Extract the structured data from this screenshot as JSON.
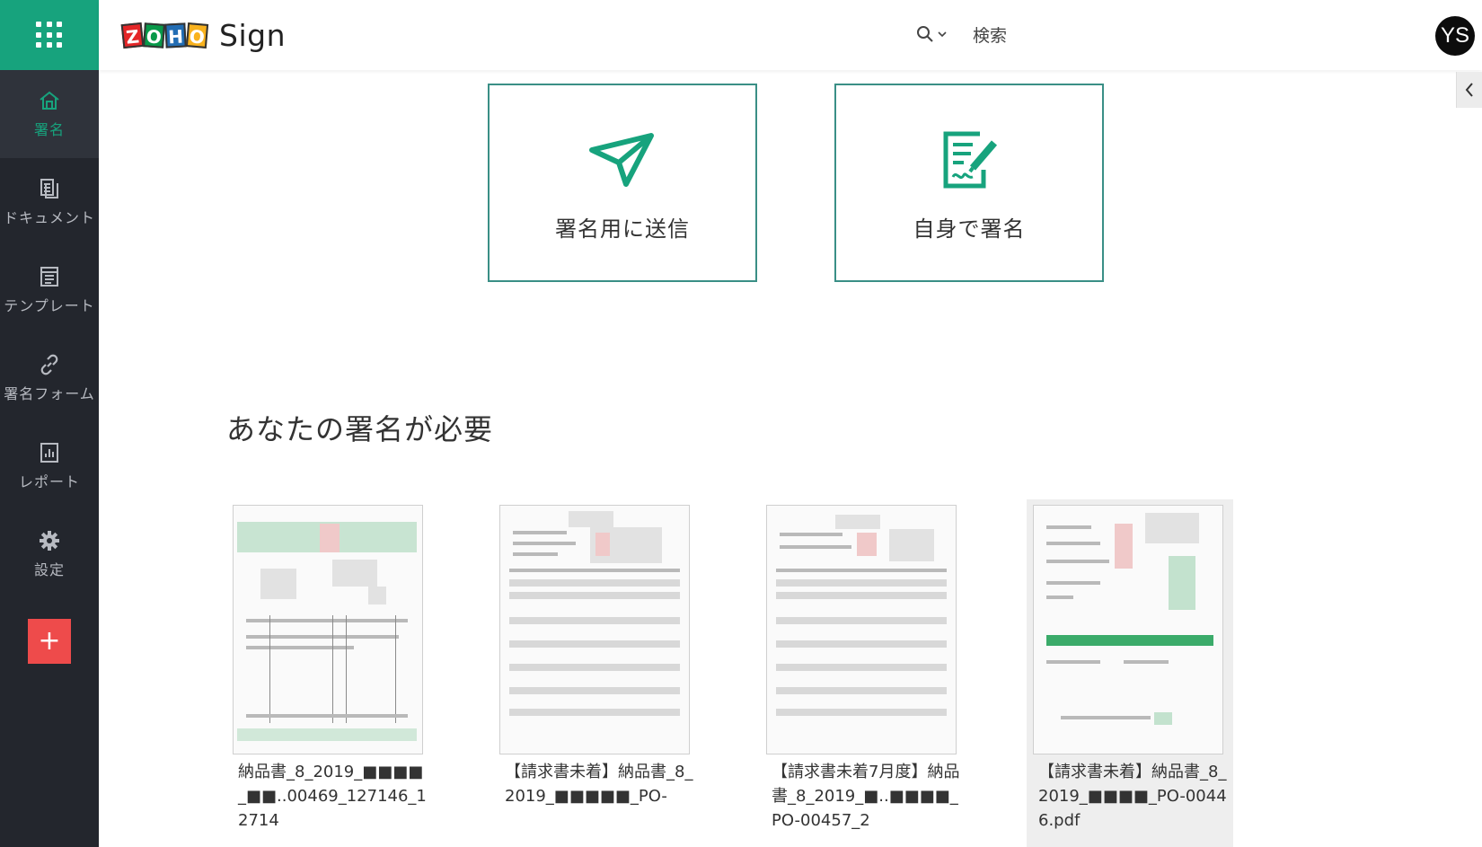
{
  "app": {
    "name": "Sign",
    "logo_letters": [
      "Z",
      "O",
      "H",
      "O"
    ],
    "accent_color": "#17a37d",
    "add_color": "#ee4b4b"
  },
  "header": {
    "search_label": "検索",
    "user_initials": "YS"
  },
  "sidebar": {
    "items": [
      {
        "label": "署名",
        "icon": "home-icon",
        "active": true
      },
      {
        "label": "ドキュメント",
        "icon": "documents-icon",
        "active": false
      },
      {
        "label": "テンプレート",
        "icon": "template-icon",
        "active": false
      },
      {
        "label": "署名フォーム",
        "icon": "link-icon",
        "active": false
      },
      {
        "label": "レポート",
        "icon": "report-icon",
        "active": false
      },
      {
        "label": "設定",
        "icon": "gear-icon",
        "active": false
      }
    ],
    "add_label": "+"
  },
  "actions": [
    {
      "label": "署名用に送信",
      "icon": "paper-plane-icon"
    },
    {
      "label": "自身で署名",
      "icon": "sign-document-icon"
    }
  ],
  "section": {
    "title": "あなたの署名が必要"
  },
  "documents": [
    {
      "name": "納品書_8_2019_■■■■_■■..00469_127146_12714"
    },
    {
      "name": "【請求書未着】納品書_8_2019_■■■■■_PO-"
    },
    {
      "name": "【請求書未着7月度】納品書_8_2019_■..■■■■_PO-00457_2"
    },
    {
      "name": "【請求書未着】納品書_8_2019_■■■■_PO-00446.pdf"
    }
  ]
}
